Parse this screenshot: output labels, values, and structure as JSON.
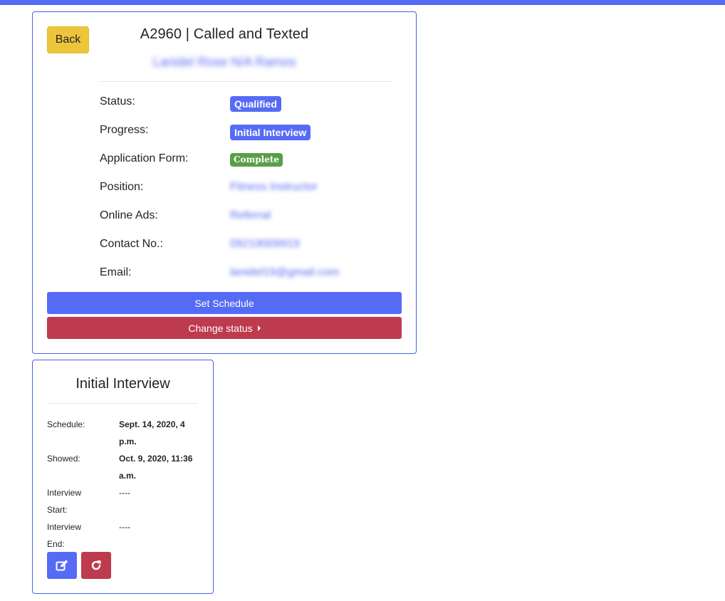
{
  "colors": {
    "primary": "#566bf5",
    "danger": "#bd3b4d",
    "warning": "#ecc53a",
    "success": "#5a9e48"
  },
  "main": {
    "back_label": "Back",
    "title": "A2960 | Called and Texted",
    "applicant_name": "Lanidel Rose N/A Ramos",
    "fields": [
      {
        "label": "Status:",
        "value": "Qualified"
      },
      {
        "label": "Progress:",
        "value": "Initial Interview"
      },
      {
        "label": "Application Form:",
        "value": "Complete"
      },
      {
        "label": "Position:",
        "value": "Fitness Instructor"
      },
      {
        "label": "Online Ads:",
        "value": "Referral"
      },
      {
        "label": "Contact No.:",
        "value": "09219009919"
      },
      {
        "label": "Email:",
        "value": "lanidel19@gmail.com"
      }
    ],
    "set_schedule_label": "Set Schedule",
    "change_status_label": "Change status"
  },
  "interview": {
    "title": "Initial Interview",
    "rows": [
      {
        "label": "Schedule:",
        "value": "Sept. 14, 2020, 4 p.m."
      },
      {
        "label": "Showed:",
        "value": "Oct. 9, 2020, 11:36 a.m."
      },
      {
        "label": "Interview Start:",
        "value": "----"
      },
      {
        "label": "Interview End:",
        "value": "----"
      }
    ],
    "icons": [
      "edit-icon",
      "redo-icon"
    ]
  }
}
